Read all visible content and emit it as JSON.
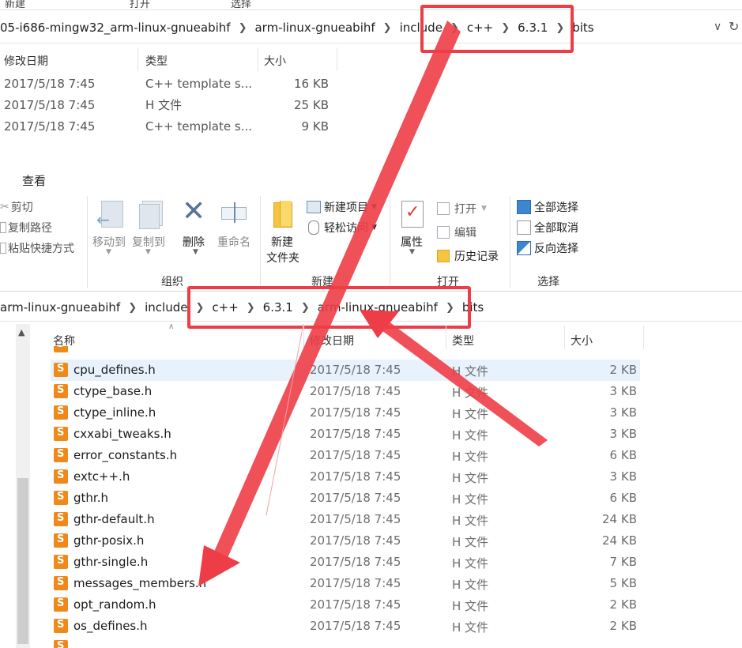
{
  "top": {
    "ribbon_labels": [
      "新建",
      "打开",
      "选择"
    ],
    "breadcrumb": [
      "05-i686-mingw32_arm-linux-gnueabihf",
      "arm-linux-gnueabihf",
      "include",
      "c++",
      "6.3.1",
      "bits"
    ],
    "columns": [
      "修改日期",
      "类型",
      "大小"
    ],
    "rows": [
      {
        "date": "2017/5/18 7:45",
        "type": "C++ template s...",
        "size": "16 KB"
      },
      {
        "date": "2017/5/18 7:45",
        "type": "H 文件",
        "size": "25 KB"
      },
      {
        "date": "2017/5/18 7:45",
        "type": "C++ template s...",
        "size": "9 KB"
      }
    ]
  },
  "ribbon": {
    "tab_view": "查看",
    "clipboard": {
      "cut": "剪切",
      "copy_path": "复制路径",
      "paste_shortcut": "粘贴快捷方式"
    },
    "organize": {
      "move_to": "移动到",
      "copy_to": "复制到",
      "delete": "删除",
      "rename": "重命名",
      "label": "组织"
    },
    "new": {
      "new_folder_line1": "新建",
      "new_folder_line2": "文件夹",
      "new_item": "新建项目",
      "easy_access": "轻松访问",
      "label": "新建"
    },
    "open": {
      "properties": "属性",
      "open": "打开",
      "edit": "编辑",
      "history": "历史记录",
      "label": "打开"
    },
    "select": {
      "select_all": "全部选择",
      "select_none": "全部取消",
      "invert": "反向选择",
      "label": "选择"
    }
  },
  "bottom": {
    "breadcrumb": [
      "arm-linux-gnueabihf",
      "include",
      "c++",
      "6.3.1",
      "arm-linux-gnueabihf",
      "bits"
    ],
    "columns": {
      "name": "名称",
      "date": "修改日期",
      "type": "类型",
      "size": "大小"
    },
    "files": [
      {
        "name": "cpu_defines.h",
        "date": "2017/5/18 7:45",
        "type": "H 文件",
        "size": "2 KB"
      },
      {
        "name": "ctype_base.h",
        "date": "2017/5/18 7:45",
        "type": "H 文件",
        "size": "3 KB"
      },
      {
        "name": "ctype_inline.h",
        "date": "2017/5/18 7:45",
        "type": "H 文件",
        "size": "3 KB"
      },
      {
        "name": "cxxabi_tweaks.h",
        "date": "2017/5/18 7:45",
        "type": "H 文件",
        "size": "3 KB"
      },
      {
        "name": "error_constants.h",
        "date": "2017/5/18 7:45",
        "type": "H 文件",
        "size": "6 KB"
      },
      {
        "name": "extc++.h",
        "date": "2017/5/18 7:45",
        "type": "H 文件",
        "size": "3 KB"
      },
      {
        "name": "gthr.h",
        "date": "2017/5/18 7:45",
        "type": "H 文件",
        "size": "6 KB"
      },
      {
        "name": "gthr-default.h",
        "date": "2017/5/18 7:45",
        "type": "H 文件",
        "size": "24 KB"
      },
      {
        "name": "gthr-posix.h",
        "date": "2017/5/18 7:45",
        "type": "H 文件",
        "size": "24 KB"
      },
      {
        "name": "gthr-single.h",
        "date": "2017/5/18 7:45",
        "type": "H 文件",
        "size": "7 KB"
      },
      {
        "name": "messages_members.h",
        "date": "2017/5/18 7:45",
        "type": "H 文件",
        "size": "5 KB"
      },
      {
        "name": "opt_random.h",
        "date": "2017/5/18 7:45",
        "type": "H 文件",
        "size": "2 KB"
      },
      {
        "name": "os_defines.h",
        "date": "2017/5/18 7:45",
        "type": "H 文件",
        "size": "2 KB"
      }
    ]
  },
  "colors": {
    "annotation": "#ee3d46",
    "selected_row": "#e8f2fc",
    "file_icon": "#ef8a1a"
  }
}
